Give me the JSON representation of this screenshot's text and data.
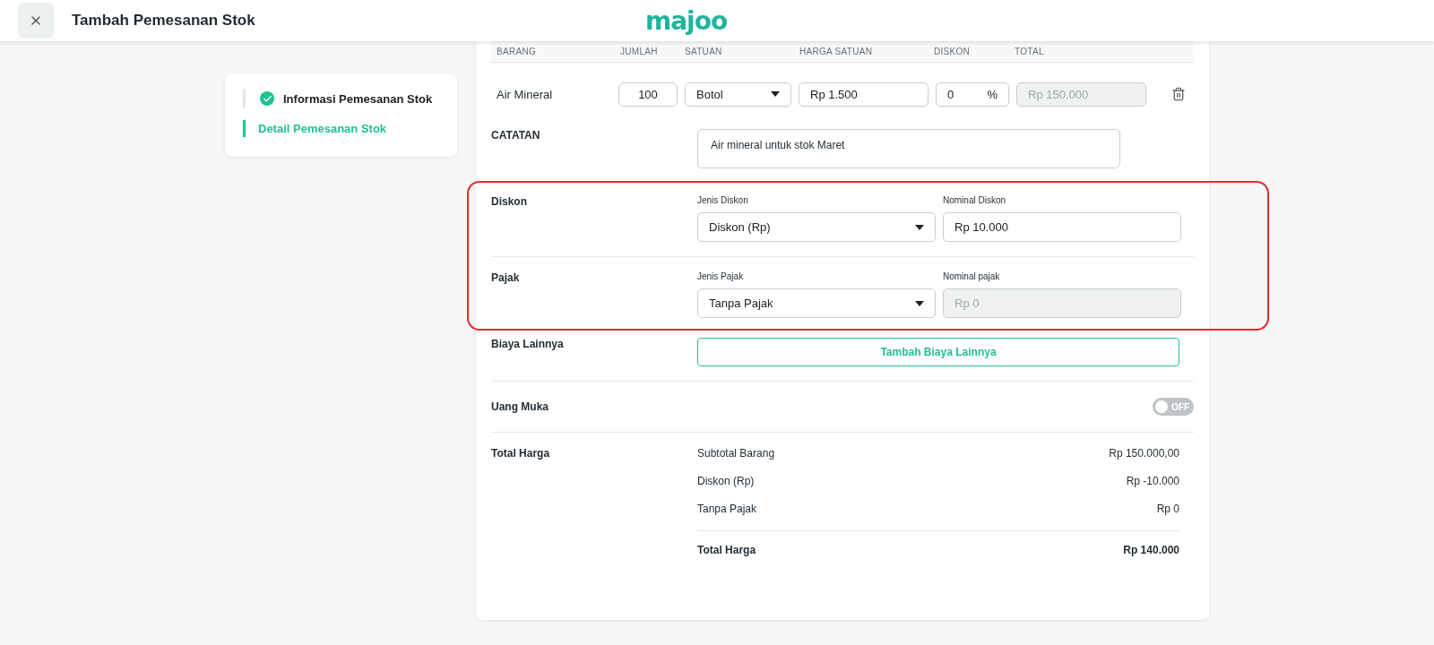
{
  "header": {
    "title": "Tambah Pemesanan Stok",
    "logo": "majoo"
  },
  "steps": [
    {
      "label": "Informasi Pemesanan Stok",
      "done": true,
      "selected": false
    },
    {
      "label": "Detail Pemesanan Stok",
      "done": false,
      "selected": true
    }
  ],
  "table": {
    "columns": [
      "BARANG",
      "JUMLAH",
      "SATUAN",
      "HARGA SATUAN",
      "DISKON",
      "TOTAL"
    ],
    "rows": [
      {
        "name": "Air Mineral",
        "qty": "100",
        "unit": "Botol",
        "price": "Rp 1.500",
        "discount": "0",
        "discount_unit": "%",
        "total": "Rp 150.000"
      }
    ]
  },
  "note": {
    "label": "CATATAN",
    "value": "Air mineral untuk stok Maret"
  },
  "highlighted_sections": [
    {
      "label": "Diskon",
      "type_label": "Jenis Diskon",
      "type_value": "Diskon (Rp)",
      "amount_label": "Nominal Diskon",
      "amount_value": "Rp 10.000",
      "amount_disabled": false
    },
    {
      "label": "Pajak",
      "type_label": "Jenis Pajak",
      "type_value": "Tanpa Pajak",
      "amount_label": "Nominal pajak",
      "amount_value": "Rp 0",
      "amount_disabled": true
    }
  ],
  "other_costs": {
    "label": "Biaya Lainnya",
    "button": "Tambah Biaya Lainnya"
  },
  "down_payment": {
    "label": "Uang Muka",
    "on": false,
    "toggle_text": "OFF"
  },
  "summary": {
    "label": "Total Harga",
    "lines": [
      {
        "label": "Subtotal Barang",
        "value": "Rp 150.000,00"
      },
      {
        "label": "Diskon (Rp)",
        "value": "Rp -10.000"
      },
      {
        "label": "Tanpa Pajak",
        "value": "Rp 0"
      }
    ],
    "total_label": "Total Harga",
    "total_value": "Rp 140.000"
  }
}
